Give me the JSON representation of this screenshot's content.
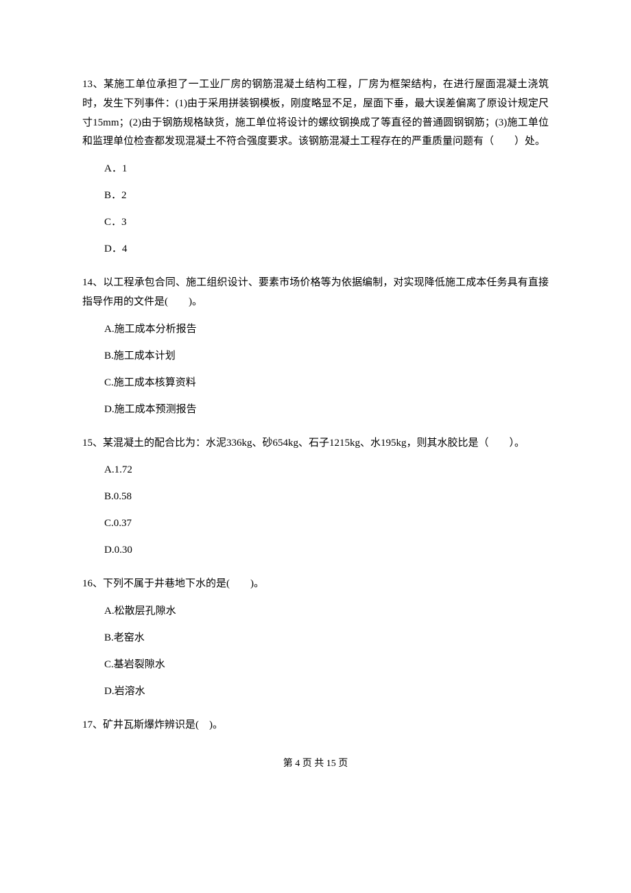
{
  "questions": [
    {
      "number": "13、",
      "text": "某施工单位承担了一工业厂房的钢筋混凝土结构工程，厂房为框架结构，在进行屋面混凝土浇筑时，发生下列事件：(1)由于采用拼装钢模板，刚度略显不足，屋面下垂，最大误差偏离了原设计规定尺寸15mm；(2)由于钢筋规格缺货，施工单位将设计的螺纹钢换成了等直径的普通圆钢钢筋；(3)施工单位和监理单位检查都发现混凝土不符合强度要求。该钢筋混凝土工程存在的严重质量问题有（　　）处。",
      "options": [
        "A．1",
        "B．2",
        "C．3",
        "D．4"
      ]
    },
    {
      "number": "14、",
      "text": "以工程承包合同、施工组织设计、要素市场价格等为依据编制，对实现降低施工成本任务具有直接指导作用的文件是(　　)。",
      "options": [
        "A.施工成本分析报告",
        "B.施工成本计划",
        "C.施工成本核算资料",
        "D.施工成本预测报告"
      ]
    },
    {
      "number": "15、",
      "text": "某混凝土的配合比为：水泥336kg、砂654kg、石子1215kg、水195kg，则其水胶比是（　　）。",
      "options": [
        "A.1.72",
        "B.0.58",
        "C.0.37",
        "D.0.30"
      ]
    },
    {
      "number": "16、",
      "text": "下列不属于井巷地下水的是(　　)。",
      "options": [
        "A.松散层孔隙水",
        "B.老窑水",
        "C.基岩裂隙水",
        "D.岩溶水"
      ]
    },
    {
      "number": "17、",
      "text": "矿井瓦斯爆炸辨识是(　)。",
      "options": []
    }
  ],
  "footer": "第 4 页 共 15 页"
}
